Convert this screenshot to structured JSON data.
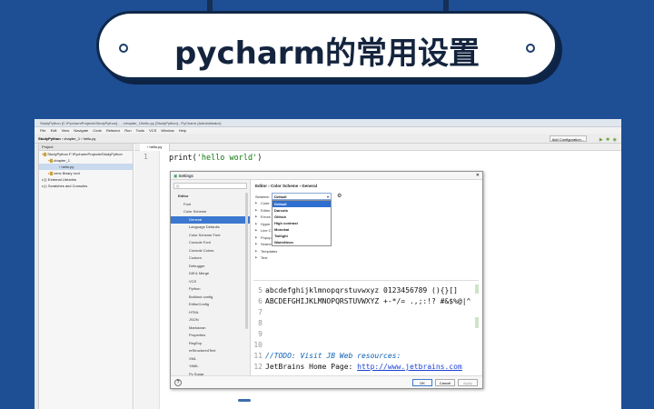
{
  "banner": {
    "title": "pycharm的常用设置"
  },
  "ide": {
    "window_title": "StudyPython [C:\\PycharmProjects\\StudyPython] - ...\\chapter_1\\hello.py [StudyPython] - PyCharm (Administrator)",
    "menu": [
      "File",
      "Edit",
      "View",
      "Navigate",
      "Code",
      "Refactor",
      "Run",
      "Tools",
      "VCS",
      "Window",
      "Help"
    ],
    "breadcrumbs": [
      "StudyPython",
      "chapter_1",
      "hello.py"
    ],
    "add_configuration": "Add Configuration...",
    "project_header": "Project",
    "project_tree": [
      {
        "label": "StudyPython  F:\\PycharmProjects\\StudyPython"
      },
      {
        "label": "chapter_1"
      },
      {
        "label": "hello.py"
      },
      {
        "label": "venv  library root"
      },
      {
        "label": "External Libraries"
      },
      {
        "label": "Scratches and Consoles"
      }
    ],
    "editor_tab": "hello.py",
    "line_number": "1",
    "code": {
      "fn": "print(",
      "str": "'hello world'",
      "end": ")"
    }
  },
  "settings": {
    "title": "Settings",
    "search_placeholder": "Q",
    "left_items": [
      "Editor",
      "Font",
      "Color Scheme",
      "General",
      "Language Defaults",
      "Color Scheme Font",
      "Console Font",
      "Console Colors",
      "Custom",
      "Debugger",
      "Diff & Merge",
      "VCS",
      "Python",
      "Buildout config",
      "EditorConfig",
      "HTML",
      "JSON",
      "Markdown",
      "Properties",
      "RegExp",
      "reStructuredText",
      "XML",
      "YAML",
      "Py Sugar"
    ],
    "selected_item": "General",
    "breadcrumb": "Editor  ›  Color Scheme  ›  General",
    "scheme_label": "Scheme:",
    "scheme_value": "Default",
    "scheme_options": [
      "Default",
      "Darcula",
      "Github",
      "High contrast",
      "Monokai",
      "Twilight",
      "WarmNeon"
    ],
    "tree": [
      "Code",
      "Editor",
      "Errors",
      "Hyper",
      "Line C",
      "Popup",
      "Search Results",
      "Templates",
      "Text"
    ],
    "preview": [
      {
        "n": "5",
        "text": "abcdefghijklmnopqrstuvwxyz 0123456789 (){}[]"
      },
      {
        "n": "6",
        "text": "ABCDEFGHIJKLMNOPQRSTUVWXYZ +-*/= .,;:!? #&$%@|^"
      },
      {
        "n": "7",
        "text": ""
      },
      {
        "n": "8",
        "text": ""
      },
      {
        "n": "9",
        "text": ""
      },
      {
        "n": "10",
        "text": ""
      },
      {
        "n": "11",
        "todo": "//TODO: Visit JB Web resources:"
      },
      {
        "n": "12",
        "label": "JetBrains Home Page: ",
        "link": "http://www.jetbrains.com"
      }
    ],
    "buttons": {
      "ok": "OK",
      "cancel": "Cancel",
      "apply": "Apply"
    },
    "help": "?"
  }
}
